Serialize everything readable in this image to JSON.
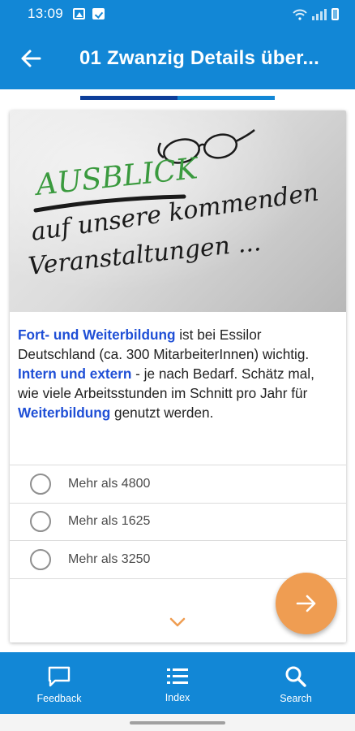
{
  "status_bar": {
    "time": "13:09",
    "icons": [
      "image-icon",
      "checkbox-icon",
      "wifi-icon",
      "signal-icon",
      "battery-icon"
    ]
  },
  "app_bar": {
    "title": "01 Zwanzig Details über...",
    "back_icon": "arrow-left-icon"
  },
  "progress": {
    "fraction": 0.5
  },
  "card": {
    "image": {
      "line1": "AUSBLICK",
      "line2": "auf unsere kommenden",
      "line3": "Veranstaltungen ..."
    },
    "question": {
      "p1_hl": "Fort- und Weiterbildung",
      "p2": " ist bei Essilor Deutschland (ca. 300 MitarbeiterInnen) wichtig. ",
      "p3_hl": "Intern und extern",
      "p4": " - je nach Bedarf. Schätz mal, wie viele Arbeitsstunden im Schnitt pro Jahr für ",
      "p5_hl": "Weiterbildung",
      "p6": " genutzt werden."
    },
    "answers": [
      {
        "label": "Mehr als 4800"
      },
      {
        "label": "Mehr als 1625"
      },
      {
        "label": "Mehr als 3250"
      }
    ]
  },
  "fab": {
    "icon": "arrow-right-icon"
  },
  "bottom_nav": {
    "items": [
      {
        "label": "Feedback",
        "icon": "chat-icon"
      },
      {
        "label": "Index",
        "icon": "list-icon"
      },
      {
        "label": "Search",
        "icon": "search-icon"
      }
    ]
  },
  "colors": {
    "primary": "#1287d6",
    "progress_fill": "#0d3e9a",
    "highlight": "#1f4fd6",
    "fab": "#ef9d52",
    "chevron": "#ef9d52"
  }
}
